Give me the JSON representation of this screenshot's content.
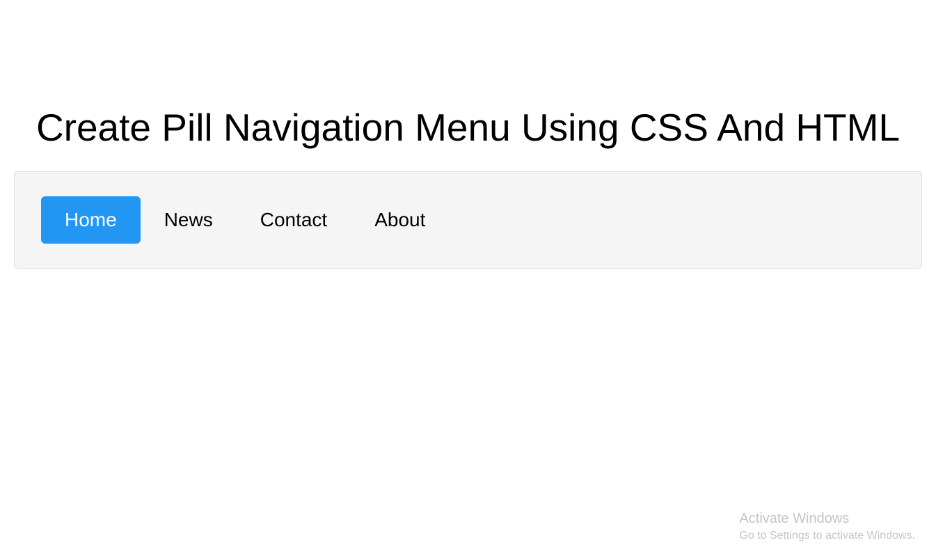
{
  "heading": "Create Pill Navigation Menu Using CSS And HTML",
  "nav": {
    "items": [
      {
        "label": "Home",
        "active": true
      },
      {
        "label": "News",
        "active": false
      },
      {
        "label": "Contact",
        "active": false
      },
      {
        "label": "About",
        "active": false
      }
    ]
  },
  "watermark": {
    "title": "Activate Windows",
    "subtitle": "Go to Settings to activate Windows."
  }
}
